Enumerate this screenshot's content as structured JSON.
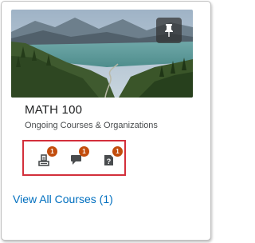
{
  "course": {
    "title": "MATH 100",
    "subtitle": "Ongoing Courses & Organizations"
  },
  "updates": [
    {
      "icon": "assignments-icon",
      "count": "1"
    },
    {
      "icon": "discussions-icon",
      "count": "1"
    },
    {
      "icon": "quizzes-icon",
      "count": "1"
    }
  ],
  "footer": {
    "view_all_label": "View All Courses (1)"
  },
  "colors": {
    "badge": "#c24d0d",
    "highlight_border": "#d32f3b",
    "link": "#006fbf"
  }
}
